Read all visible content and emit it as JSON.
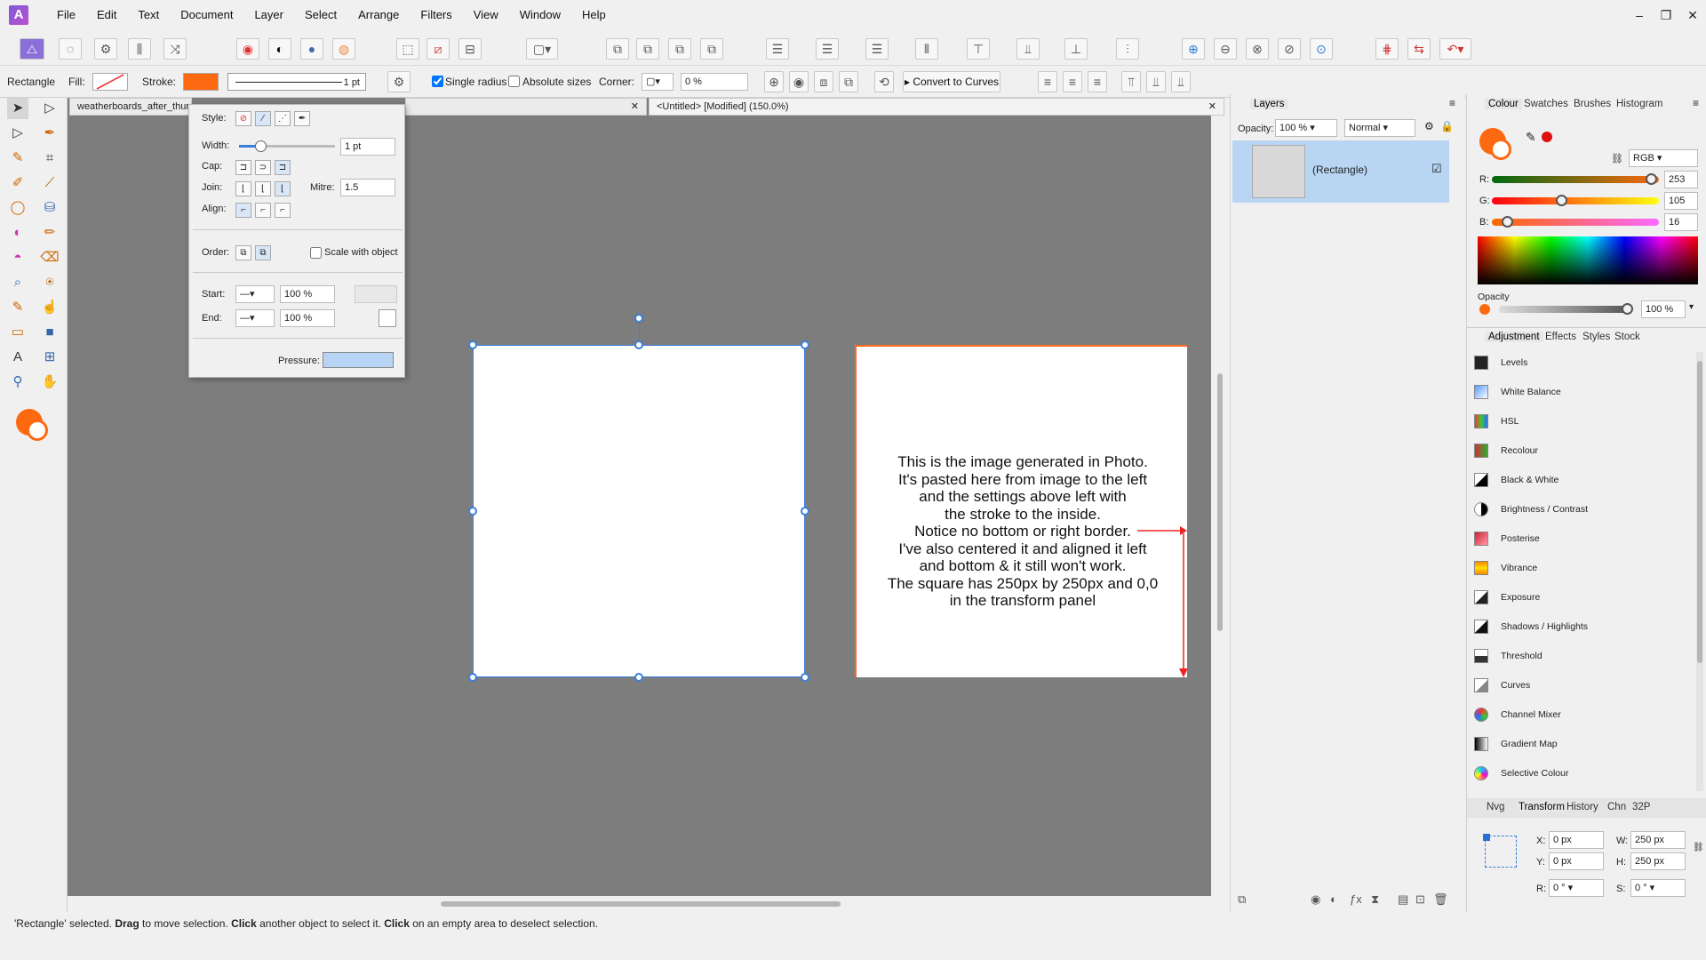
{
  "menu": [
    "File",
    "Edit",
    "Text",
    "Document",
    "Layer",
    "Select",
    "Arrange",
    "Filters",
    "View",
    "Window",
    "Help"
  ],
  "window_controls": [
    "–",
    "❐",
    "✕"
  ],
  "context": {
    "tool_name": "Rectangle",
    "fill_label": "Fill:",
    "stroke_label": "Stroke:",
    "stroke_width": "1 pt",
    "single_radius": "Single radius",
    "absolute_sizes": "Absolute sizes",
    "corner_label": "Corner:",
    "corner_value": "0 %",
    "convert_label": "Convert to Curves"
  },
  "tabs": {
    "doc1": "weatherboards_after_thum",
    "doc2": "<Untitled> [Modified] (150.0%)"
  },
  "stroke_panel": {
    "style_label": "Style:",
    "width_label": "Width:",
    "width_value": "1 pt",
    "cap_label": "Cap:",
    "join_label": "Join:",
    "mitre_label": "Mitre:",
    "mitre_value": "1.5",
    "align_label": "Align:",
    "order_label": "Order:",
    "scale_label": "Scale with object",
    "start_label": "Start:",
    "start_pct": "100 %",
    "end_label": "End:",
    "end_pct": "100 %",
    "pressure_label": "Pressure:"
  },
  "note_lines": [
    "This is the image generated in Photo.",
    "It's pasted here from image to the left",
    "and the settings above left with",
    "the stroke to the inside.",
    "Notice no bottom or right border.",
    "I've also centered it and aligned it left",
    "and bottom & it still won't work.",
    "The square has 250px by 250px and 0,0",
    "in the transform panel"
  ],
  "layers": {
    "tab": "Layers",
    "opacity_label": "Opacity:",
    "opacity_value": "100 %",
    "blend": "Normal",
    "item": "(Rectangle)"
  },
  "colour": {
    "tabs": [
      "Colour",
      "Swatches",
      "Brushes",
      "Histogram"
    ],
    "model": "RGB",
    "r_label": "R:",
    "r": "253",
    "r_pct": 0.99,
    "g_label": "G:",
    "g": "105",
    "g_pct": 0.41,
    "b_label": "B:",
    "b": "16",
    "b_pct": 0.06,
    "opacity_label": "Opacity",
    "opacity": "100 %",
    "current": "#fd6910"
  },
  "adjust_tabs": [
    "Adjustment",
    "Effects",
    "Styles",
    "Stock"
  ],
  "adjustments": [
    "Levels",
    "White Balance",
    "HSL",
    "Recolour",
    "Black & White",
    "Brightness / Contrast",
    "Posterise",
    "Vibrance",
    "Exposure",
    "Shadows / Highlights",
    "Threshold",
    "Curves",
    "Channel Mixer",
    "Gradient Map",
    "Selective Colour"
  ],
  "transform": {
    "tabs": [
      "Nvg",
      "Transform",
      "History",
      "Chn",
      "32P"
    ],
    "x_label": "X:",
    "x": "0 px",
    "y_label": "Y:",
    "y": "0 px",
    "w_label": "W:",
    "w": "250 px",
    "h_label": "H:",
    "h": "250 px",
    "r_label": "R:",
    "r": "0 °",
    "s_label": "S:",
    "s": "0 °"
  },
  "status": {
    "sel": "'Rectangle' selected.",
    "drag": "Drag",
    "drag_txt": "to move selection.",
    "click": "Click",
    "click_txt": "another object to select it.",
    "click2": "Click",
    "click2_txt": "on an empty area to deselect selection."
  }
}
